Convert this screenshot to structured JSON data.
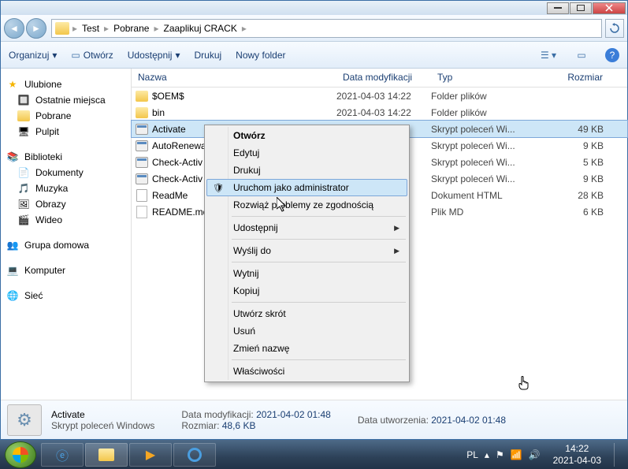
{
  "breadcrumbs": [
    "Test",
    "Pobrane",
    "Zaaplikuj CRACK"
  ],
  "toolbar": {
    "organize": "Organizuj",
    "open": "Otwórz",
    "share": "Udostępnij",
    "print": "Drukuj",
    "newfolder": "Nowy folder"
  },
  "columns": {
    "name": "Nazwa",
    "date": "Data modyfikacji",
    "type": "Typ",
    "size": "Rozmiar"
  },
  "sidebar": {
    "favorites": "Ulubione",
    "recent": "Ostatnie miejsca",
    "downloads": "Pobrane",
    "desktop": "Pulpit",
    "libraries": "Biblioteki",
    "documents": "Dokumenty",
    "music": "Muzyka",
    "pictures": "Obrazy",
    "videos": "Wideo",
    "homegroup": "Grupa domowa",
    "computer": "Komputer",
    "network": "Sieć"
  },
  "files": [
    {
      "name": "$OEM$",
      "date": "2021-04-03 14:22",
      "type": "Folder plików",
      "size": "",
      "icon": "folder"
    },
    {
      "name": "bin",
      "date": "2021-04-03 14:22",
      "type": "Folder plików",
      "size": "",
      "icon": "folder"
    },
    {
      "name": "Activate",
      "date": "",
      "type": "Skrypt poleceń Wi...",
      "size": "49 KB",
      "icon": "cmd",
      "selected": true
    },
    {
      "name": "AutoRenewa",
      "date": "",
      "type": "Skrypt poleceń Wi...",
      "size": "9 KB",
      "icon": "cmd"
    },
    {
      "name": "Check-Activ",
      "date": "",
      "type": "Skrypt poleceń Wi...",
      "size": "5 KB",
      "icon": "cmd"
    },
    {
      "name": "Check-Activ",
      "date": "",
      "type": "Skrypt poleceń Wi...",
      "size": "9 KB",
      "icon": "cmd"
    },
    {
      "name": "ReadMe",
      "date": "",
      "type": "Dokument HTML",
      "size": "28 KB",
      "icon": "html"
    },
    {
      "name": "README.md",
      "date": "",
      "type": "Plik MD",
      "size": "6 KB",
      "icon": "txt"
    }
  ],
  "context": {
    "open": "Otwórz",
    "edit": "Edytuj",
    "print": "Drukuj",
    "runadmin": "Uruchom jako administrator",
    "compat": "Rozwiąż problemy ze zgodnością",
    "share": "Udostępnij",
    "sendto": "Wyślij do",
    "cut": "Wytnij",
    "copy": "Kopiuj",
    "shortcut": "Utwórz skrót",
    "delete": "Usuń",
    "rename": "Zmień nazwę",
    "properties": "Właściwości"
  },
  "details": {
    "name": "Activate",
    "type": "Skrypt poleceń Windows",
    "mod_label": "Data modyfikacji:",
    "mod_value": "2021-04-02 01:48",
    "created_label": "Data utworzenia:",
    "created_value": "2021-04-02 01:48",
    "size_label": "Rozmiar:",
    "size_value": "48,6 KB"
  },
  "tray": {
    "lang": "PL",
    "time": "14:22",
    "date": "2021-04-03"
  }
}
